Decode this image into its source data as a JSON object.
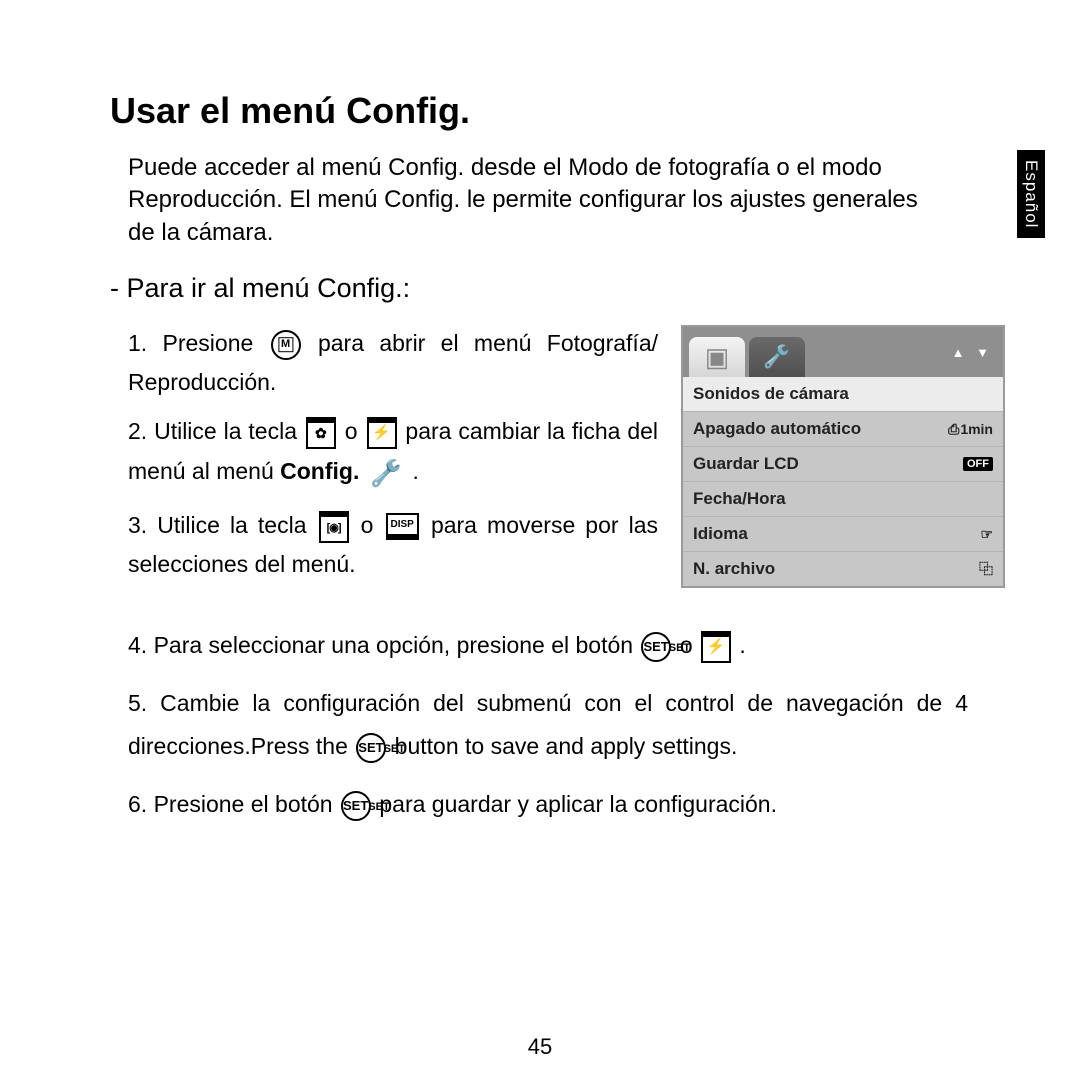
{
  "title": "Usar el menú Config.",
  "intro": "Puede acceder al menú Config. desde el Modo de fotografía o el modo Reproducción. El menú Config. le permite configurar los ajustes generales de la cámara.",
  "subhead": "-  Para ir al menú Config.:",
  "lang_tab": "Español",
  "page_number": "45",
  "steps": {
    "s1a": "1. Presione ",
    "s1b": " para abrir el menú Fotografía/ Reproducción.",
    "s2a": "2. Utilice la tecla ",
    "s2_o": " o ",
    "s2b": " para cambiar la ficha del menú al menú ",
    "s2_config": "Config.",
    "s2_dot": " .",
    "s3a": "3. Utilice la tecla ",
    "s3b": " para moverse por las selecciones del menú.",
    "s4a": "4. Para seleccionar una opción, presione el botón ",
    "s4b": " .",
    "s5a": "5. Cambie la configuración del submenú con el control de navegación de 4 direcciones.Press the ",
    "s5b": " button to save and apply settings.",
    "s6a": "6. Presione el botón ",
    "s6b": " para guardar y aplicar la configuración."
  },
  "lcd": {
    "arrows": "▲  ▼",
    "rows": [
      {
        "label": "Sonidos de cámara",
        "value": ""
      },
      {
        "label": "Apagado automático",
        "value": "1min"
      },
      {
        "label": "Guardar LCD",
        "value": "OFF"
      },
      {
        "label": "Fecha/Hora",
        "value": ""
      },
      {
        "label": "Idioma",
        "value": "☞"
      },
      {
        "label": "N. archivo",
        "value": "⿻"
      }
    ]
  }
}
